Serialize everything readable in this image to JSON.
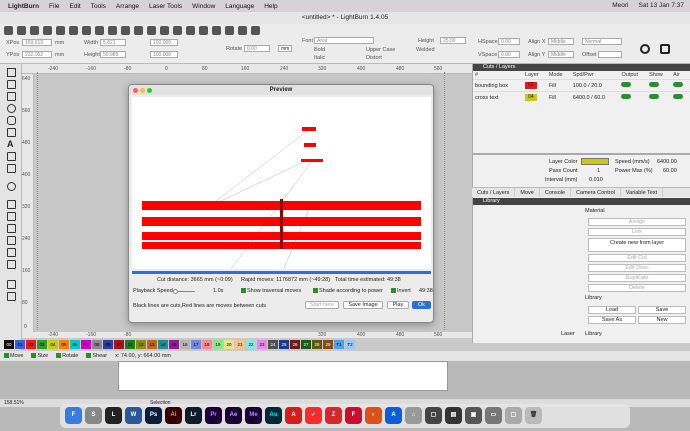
{
  "menubar": {
    "app": "LightBurn",
    "items": [
      "File",
      "Edit",
      "Tools",
      "Arrange",
      "Laser Tools",
      "Window",
      "Language",
      "Help"
    ],
    "user": "Meori",
    "clock": "Sat 13 Jan  7:37"
  },
  "window": {
    "title": "<untitled> * - LightBurn 1.4.05"
  },
  "toolbar": {
    "xpos_label": "XPos",
    "xpos": "169.619",
    "ypos_label": "YPos",
    "ypos": "232.052",
    "unit": "mm",
    "width_label": "Width",
    "width": "5.821",
    "height_label": "Height",
    "height": "50.089",
    "pct_w": "100.000",
    "pct_h": "100.000",
    "rotate_label": "Rotate",
    "rotate": "0.00",
    "mm_btn": "mm",
    "font_label": "Font",
    "font": "Arial",
    "height2_label": "Height",
    "height2": "25.00",
    "hspace_label": "HSpace",
    "hspace": "0.00",
    "vspace_label": "VSpace",
    "vspace": "0.00",
    "alignx_label": "Align X",
    "alignx": "Middle",
    "aligny_label": "Align Y",
    "aligny": "Middle",
    "normal": "Normal",
    "offset": "Offset",
    "bold": "Bold",
    "italic": "Italic",
    "upper": "Upper Case",
    "distort": "Distort",
    "welded": "Welded"
  },
  "rulers": {
    "top": [
      "-240",
      "-160",
      "-80",
      "0",
      "80",
      "160",
      "240",
      "320",
      "400",
      "480",
      "560"
    ],
    "left": [
      "640",
      "560",
      "480",
      "400",
      "320",
      "240",
      "160",
      "80",
      "0"
    ],
    "bottom": [
      "-240",
      "-160",
      "-80",
      "0",
      "80",
      "160",
      "240",
      "320",
      "400",
      "480",
      "560"
    ]
  },
  "cuts": {
    "title": "Cuts / Layers",
    "headers": [
      "#",
      "Layer",
      "Mode",
      "Spd/Pwr",
      "Output",
      "Show",
      "Air"
    ],
    "rows": [
      {
        "name": "bounding box",
        "layer": "02",
        "color": "#e81b1b",
        "mode": "Fill",
        "spdpwr": "100.0 / 20.0"
      },
      {
        "name": "cross text",
        "layer": "04",
        "color": "#c8c81a",
        "mode": "Fill",
        "spdpwr": "6400.0 / 60.0"
      }
    ],
    "layer_color_label": "Layer Color",
    "speed_label": "Speed (mm/s)",
    "speed": "6400.00",
    "pass_label": "Pass Count",
    "pass": "1",
    "power_label": "Power Max (%)",
    "power": "60.00",
    "interval_label": "Interval (mm)",
    "interval": "0.010"
  },
  "tabs1": [
    "Cuts / Layers",
    "Move",
    "Console",
    "Camera Control",
    "Variable Text"
  ],
  "library": {
    "title": "Library",
    "material_label": "Material",
    "buttons": [
      "Assign",
      "Link",
      "Create new from layer",
      "Edit Cut",
      "Edit Desc",
      "Duplicate",
      "Delete"
    ],
    "library_label": "Library",
    "load": "Load",
    "save": "Save",
    "save_as": "Save As",
    "new": "New",
    "tabs": [
      "Laser",
      "Library"
    ]
  },
  "preview": {
    "title": "Preview",
    "cut_distance": "Cut distance: 3665 mm (~0:09)",
    "rapid": "Rapid moves: 1176872 mm (~49:28)",
    "total": "Total time estimated: 49:38",
    "playback_label": "Playback Speed",
    "speed": "1.0x",
    "show_traversal": "Show traversal moves",
    "shade": "Shade according to power",
    "invert": "Invert",
    "time": "49:38",
    "legend": "Black lines are cuts,Red lines are moves between cuts",
    "start_here": "Start here",
    "save_image": "Save Image",
    "play": "Play",
    "ok": "Ok"
  },
  "palette": [
    "00",
    "01",
    "02",
    "03",
    "04",
    "05",
    "06",
    "07",
    "08",
    "09",
    "10",
    "11",
    "12",
    "13",
    "14",
    "15",
    "16",
    "17",
    "18",
    "19",
    "20",
    "21",
    "22",
    "23",
    "24",
    "25",
    "26",
    "27",
    "28",
    "29",
    "T1",
    "T2"
  ],
  "palette_colors": [
    "#111",
    "#3b5fd9",
    "#e81b1b",
    "#2aa02a",
    "#c8c81a",
    "#ff7f00",
    "#00c8c8",
    "#c800c8",
    "#8a8a8a",
    "#2b3ea8",
    "#a01818",
    "#1c7f1c",
    "#8a8a14",
    "#c8641c",
    "#1c9090",
    "#901c90",
    "#b4b4b4",
    "#6e8ae6",
    "#ff8a8a",
    "#8ae68a",
    "#e6e68a",
    "#ffc08a",
    "#8ae6e6",
    "#e68ae6",
    "#505050",
    "#1c3a8a",
    "#6e1a1a",
    "#1c5a1c",
    "#5a5a10",
    "#8a4a10",
    "#4fa0e6",
    "#9ac8f0"
  ],
  "status": {
    "move": "Move",
    "size": "Size",
    "rotate": "Rotate",
    "shear": "Shear",
    "coords": "x: 74.00, y: 664.00 mm"
  },
  "desk": {
    "zoom": "158.51%",
    "selection": "Selection"
  },
  "dock": [
    "F",
    "S",
    "L",
    "W",
    "Ps",
    "Ai",
    "Lr",
    "Pr",
    "Ae",
    "Me",
    "Au",
    "A",
    "✓",
    "Z",
    "F",
    "◐",
    "A",
    "⌂",
    "▢",
    "▤",
    "▣",
    "▭",
    "▢",
    "🗑"
  ]
}
